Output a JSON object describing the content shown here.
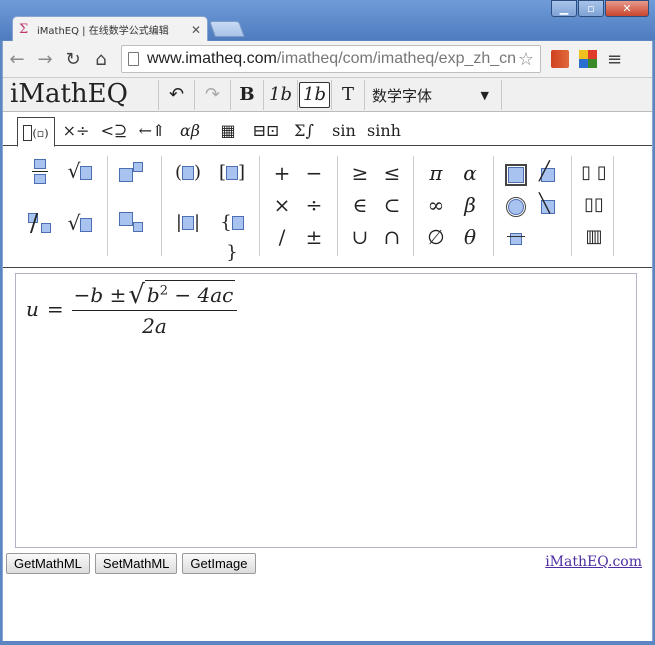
{
  "browser": {
    "tab_title": "iMathEQ | 在线数学公式编辑",
    "tab_icon": "sigma-favicon-icon",
    "url_host": "www.imatheq.com",
    "url_path": "/imatheq/com/imatheq/exp_zh_cn"
  },
  "toolbar": {
    "logo": "iMathEQ",
    "undo": "↶",
    "redo": "↷",
    "bold": "B",
    "italic": "1b",
    "upright_italic": "1b",
    "text": "T",
    "font": "数学字体"
  },
  "categories": [
    {
      "label": "⊟⊡"
    },
    {
      "label": "×÷"
    },
    {
      "label": "<⊇"
    },
    {
      "label": "←⇑"
    },
    {
      "label": "αβ"
    },
    {
      "label": "▦"
    },
    {
      "label": "⊟⊡"
    },
    {
      "label": "Σ∫"
    },
    {
      "label": "sin"
    },
    {
      "label": "sinh"
    }
  ],
  "palette": {
    "sqrt": "√",
    "nroot": "√",
    "paren": "( )",
    "bracket": "[ ]",
    "vbar": "| |",
    "brace": "{ }",
    "ops": [
      "+",
      "−",
      "×",
      "÷",
      "/",
      "±"
    ],
    "relations": [
      "≥",
      "≤",
      "∈",
      "⊂",
      "∪",
      "∩"
    ],
    "greek": [
      "π",
      "α",
      "∞",
      "β",
      "∅",
      "θ"
    ],
    "bracket_tools": [
      "⌷⌷",
      "⌷⌷",
      "⌷⌷"
    ]
  },
  "formula": {
    "lhs": "u",
    "equals": "=",
    "num_pre": "−b ±",
    "radicand_b": "b",
    "radicand_exp": "2",
    "radicand_rest": "− 4ac",
    "den": "2a"
  },
  "buttons": {
    "get_mathml": "GetMathML",
    "set_mathml": "SetMathML",
    "get_image": "GetImage"
  },
  "footer_link": "iMathEQ.com",
  "colors": {
    "accent_box": "#a9c3f0",
    "link": "#4c2ea0",
    "chrome": "#5b86c2"
  }
}
